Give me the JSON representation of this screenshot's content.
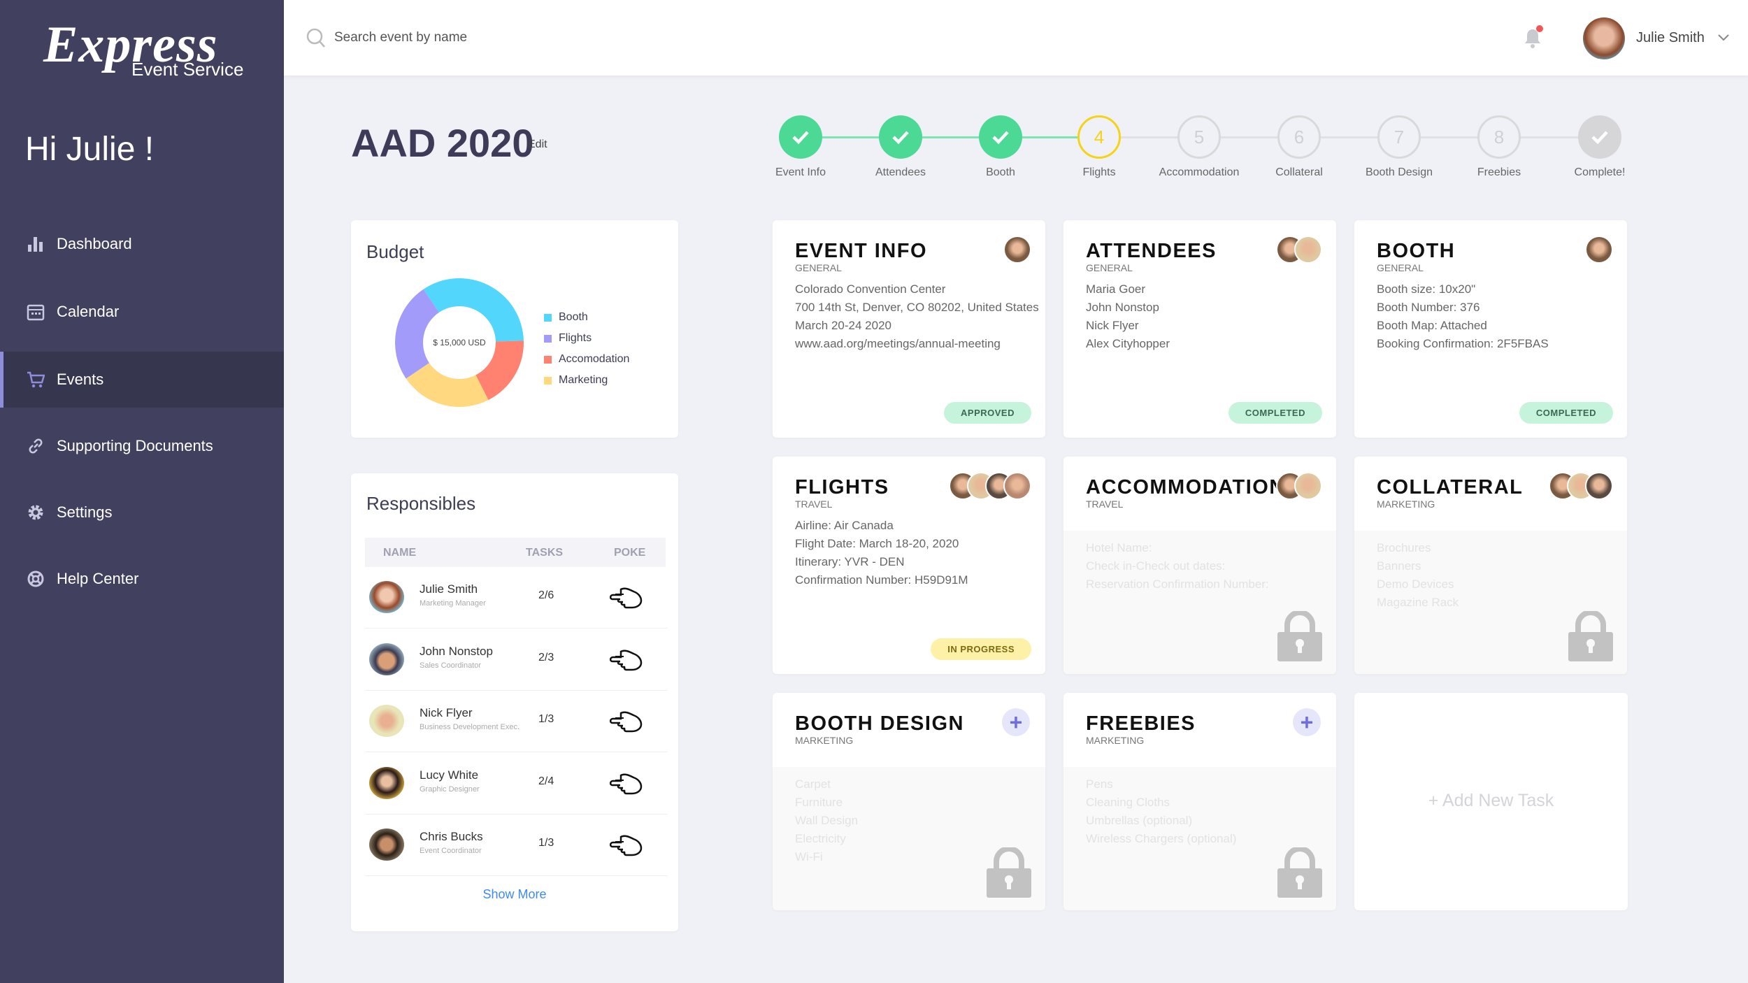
{
  "brand": {
    "logo_main": "Express",
    "logo_sub": "Event Service"
  },
  "greeting": "Hi Julie !",
  "sidebar": {
    "items": [
      {
        "label": "Dashboard",
        "icon": "bar-chart-icon"
      },
      {
        "label": "Calendar",
        "icon": "calendar-icon"
      },
      {
        "label": "Events",
        "icon": "cart-icon",
        "active": true
      },
      {
        "label": "Supporting Documents",
        "icon": "link-icon"
      },
      {
        "label": "Settings",
        "icon": "gear-icon"
      },
      {
        "label": "Help Center",
        "icon": "lifebuoy-icon"
      }
    ]
  },
  "topbar": {
    "search_placeholder": "Search event by name",
    "user_name": "Julie Smith",
    "notification_dot_color": "#f25757"
  },
  "event": {
    "title": "AAD 2020",
    "edit_label": "Edit"
  },
  "stepper": [
    {
      "label": "Event Info",
      "state": "done"
    },
    {
      "label": "Attendees",
      "state": "done"
    },
    {
      "label": "Booth",
      "state": "done"
    },
    {
      "label": "Flights",
      "state": "current",
      "number": "4"
    },
    {
      "label": "Accommodation",
      "state": "todo",
      "number": "5"
    },
    {
      "label": "Collateral",
      "state": "todo",
      "number": "6"
    },
    {
      "label": "Booth Design",
      "state": "todo",
      "number": "7"
    },
    {
      "label": "Freebies",
      "state": "todo",
      "number": "8"
    },
    {
      "label": "Complete!",
      "state": "final"
    }
  ],
  "budget": {
    "title": "Budget",
    "total": "$ 15,000 USD"
  },
  "chart_data": {
    "type": "pie",
    "donut": true,
    "categories": [
      "Booth",
      "Flights",
      "Accomodation",
      "Marketing"
    ],
    "values": [
      34,
      25,
      18,
      23
    ],
    "colors": [
      "#52d6fc",
      "#a29bfa",
      "#ff8170",
      "#ffd87f"
    ],
    "center_label": "$ 15,000 USD",
    "legend": "right"
  },
  "responsibles": {
    "title": "Responsibles",
    "columns": [
      "NAME",
      "TASKS",
      "POKE"
    ],
    "rows": [
      {
        "name": "Julie Smith",
        "role": "Marketing Manager",
        "tasks": "2/6"
      },
      {
        "name": "John Nonstop",
        "role": "Sales Coordinator",
        "tasks": "2/3"
      },
      {
        "name": "Nick Flyer",
        "role": "Business Development Exec.",
        "tasks": "1/3"
      },
      {
        "name": "Lucy White",
        "role": "Graphic Designer",
        "tasks": "2/4"
      },
      {
        "name": "Chris Bucks",
        "role": "Event Coordinator",
        "tasks": "1/3"
      }
    ],
    "show_more": "Show More"
  },
  "tasks": [
    {
      "title": "EVENT INFO",
      "category": "GENERAL",
      "lines": [
        "Colorado Convention Center",
        "700 14th St, Denver, CO 80202, United States",
        "March 20-24 2020",
        "www.aad.org/meetings/annual-meeting"
      ],
      "status": "APPROVED",
      "avatars": 1
    },
    {
      "title": "ATTENDEES",
      "category": "GENERAL",
      "lines": [
        "Maria Goer",
        "John Nonstop",
        "Nick Flyer",
        "Alex Cityhopper"
      ],
      "status": "COMPLETED",
      "avatars": 2
    },
    {
      "title": "BOOTH",
      "category": "GENERAL",
      "lines": [
        "Booth size: 10x20\"",
        "Booth Number: 376",
        "Booth Map: Attached",
        "Booking Confirmation: 2F5FBAS"
      ],
      "status": "COMPLETED",
      "avatars": 1
    },
    {
      "title": "FLIGHTS",
      "category": "TRAVEL",
      "lines": [
        "Airline: Air Canada",
        "Flight Date: March 18-20, 2020",
        "Itinerary: YVR - DEN",
        "Confirmation Number: H59D91M"
      ],
      "status": "IN PROGRESS",
      "avatars": 4
    },
    {
      "title": "ACCOMMODATION",
      "category": "TRAVEL",
      "lines": [
        "Hotel Name:",
        "Check in-Check out dates:",
        "Reservation Confirmation Number:"
      ],
      "locked": true,
      "avatars": 2
    },
    {
      "title": "COLLATERAL",
      "category": "MARKETING",
      "lines": [
        "Brochures",
        "Banners",
        "Demo Devices",
        "Magazine Rack"
      ],
      "locked": true,
      "avatars": 3
    },
    {
      "title": "BOOTH DESIGN",
      "category": "MARKETING",
      "lines": [
        "Carpet",
        "Furniture",
        "Wall Design",
        "Electricity",
        "Wi-Fi"
      ],
      "locked": true,
      "add": true
    },
    {
      "title": "FREEBIES",
      "category": "MARKETING",
      "lines": [
        "Pens",
        "Cleaning Cloths",
        "Umbrellas (optional)",
        "Wireless Chargers (optional)"
      ],
      "locked": true,
      "add": true
    }
  ],
  "add_task_label": "+ Add New Task",
  "status_colors": {
    "APPROVED": "#c6f3dc",
    "COMPLETED": "#c6f3dc",
    "IN PROGRESS": "#fdf1a8"
  }
}
